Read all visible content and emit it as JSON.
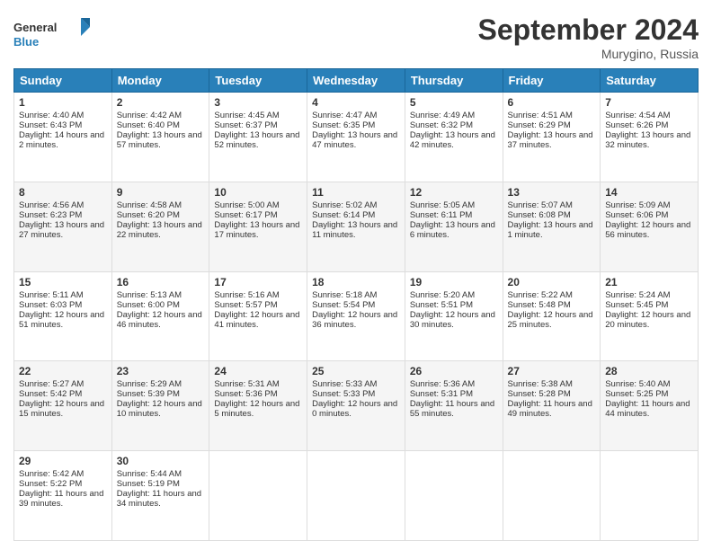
{
  "header": {
    "logo_general": "General",
    "logo_blue": "Blue",
    "month_title": "September 2024",
    "location": "Murygino, Russia"
  },
  "days_of_week": [
    "Sunday",
    "Monday",
    "Tuesday",
    "Wednesday",
    "Thursday",
    "Friday",
    "Saturday"
  ],
  "weeks": [
    [
      {
        "day": "1",
        "sunrise": "Sunrise: 4:40 AM",
        "sunset": "Sunset: 6:43 PM",
        "daylight": "Daylight: 14 hours and 2 minutes."
      },
      {
        "day": "2",
        "sunrise": "Sunrise: 4:42 AM",
        "sunset": "Sunset: 6:40 PM",
        "daylight": "Daylight: 13 hours and 57 minutes."
      },
      {
        "day": "3",
        "sunrise": "Sunrise: 4:45 AM",
        "sunset": "Sunset: 6:37 PM",
        "daylight": "Daylight: 13 hours and 52 minutes."
      },
      {
        "day": "4",
        "sunrise": "Sunrise: 4:47 AM",
        "sunset": "Sunset: 6:35 PM",
        "daylight": "Daylight: 13 hours and 47 minutes."
      },
      {
        "day": "5",
        "sunrise": "Sunrise: 4:49 AM",
        "sunset": "Sunset: 6:32 PM",
        "daylight": "Daylight: 13 hours and 42 minutes."
      },
      {
        "day": "6",
        "sunrise": "Sunrise: 4:51 AM",
        "sunset": "Sunset: 6:29 PM",
        "daylight": "Daylight: 13 hours and 37 minutes."
      },
      {
        "day": "7",
        "sunrise": "Sunrise: 4:54 AM",
        "sunset": "Sunset: 6:26 PM",
        "daylight": "Daylight: 13 hours and 32 minutes."
      }
    ],
    [
      {
        "day": "8",
        "sunrise": "Sunrise: 4:56 AM",
        "sunset": "Sunset: 6:23 PM",
        "daylight": "Daylight: 13 hours and 27 minutes."
      },
      {
        "day": "9",
        "sunrise": "Sunrise: 4:58 AM",
        "sunset": "Sunset: 6:20 PM",
        "daylight": "Daylight: 13 hours and 22 minutes."
      },
      {
        "day": "10",
        "sunrise": "Sunrise: 5:00 AM",
        "sunset": "Sunset: 6:17 PM",
        "daylight": "Daylight: 13 hours and 17 minutes."
      },
      {
        "day": "11",
        "sunrise": "Sunrise: 5:02 AM",
        "sunset": "Sunset: 6:14 PM",
        "daylight": "Daylight: 13 hours and 11 minutes."
      },
      {
        "day": "12",
        "sunrise": "Sunrise: 5:05 AM",
        "sunset": "Sunset: 6:11 PM",
        "daylight": "Daylight: 13 hours and 6 minutes."
      },
      {
        "day": "13",
        "sunrise": "Sunrise: 5:07 AM",
        "sunset": "Sunset: 6:08 PM",
        "daylight": "Daylight: 13 hours and 1 minute."
      },
      {
        "day": "14",
        "sunrise": "Sunrise: 5:09 AM",
        "sunset": "Sunset: 6:06 PM",
        "daylight": "Daylight: 12 hours and 56 minutes."
      }
    ],
    [
      {
        "day": "15",
        "sunrise": "Sunrise: 5:11 AM",
        "sunset": "Sunset: 6:03 PM",
        "daylight": "Daylight: 12 hours and 51 minutes."
      },
      {
        "day": "16",
        "sunrise": "Sunrise: 5:13 AM",
        "sunset": "Sunset: 6:00 PM",
        "daylight": "Daylight: 12 hours and 46 minutes."
      },
      {
        "day": "17",
        "sunrise": "Sunrise: 5:16 AM",
        "sunset": "Sunset: 5:57 PM",
        "daylight": "Daylight: 12 hours and 41 minutes."
      },
      {
        "day": "18",
        "sunrise": "Sunrise: 5:18 AM",
        "sunset": "Sunset: 5:54 PM",
        "daylight": "Daylight: 12 hours and 36 minutes."
      },
      {
        "day": "19",
        "sunrise": "Sunrise: 5:20 AM",
        "sunset": "Sunset: 5:51 PM",
        "daylight": "Daylight: 12 hours and 30 minutes."
      },
      {
        "day": "20",
        "sunrise": "Sunrise: 5:22 AM",
        "sunset": "Sunset: 5:48 PM",
        "daylight": "Daylight: 12 hours and 25 minutes."
      },
      {
        "day": "21",
        "sunrise": "Sunrise: 5:24 AM",
        "sunset": "Sunset: 5:45 PM",
        "daylight": "Daylight: 12 hours and 20 minutes."
      }
    ],
    [
      {
        "day": "22",
        "sunrise": "Sunrise: 5:27 AM",
        "sunset": "Sunset: 5:42 PM",
        "daylight": "Daylight: 12 hours and 15 minutes."
      },
      {
        "day": "23",
        "sunrise": "Sunrise: 5:29 AM",
        "sunset": "Sunset: 5:39 PM",
        "daylight": "Daylight: 12 hours and 10 minutes."
      },
      {
        "day": "24",
        "sunrise": "Sunrise: 5:31 AM",
        "sunset": "Sunset: 5:36 PM",
        "daylight": "Daylight: 12 hours and 5 minutes."
      },
      {
        "day": "25",
        "sunrise": "Sunrise: 5:33 AM",
        "sunset": "Sunset: 5:33 PM",
        "daylight": "Daylight: 12 hours and 0 minutes."
      },
      {
        "day": "26",
        "sunrise": "Sunrise: 5:36 AM",
        "sunset": "Sunset: 5:31 PM",
        "daylight": "Daylight: 11 hours and 55 minutes."
      },
      {
        "day": "27",
        "sunrise": "Sunrise: 5:38 AM",
        "sunset": "Sunset: 5:28 PM",
        "daylight": "Daylight: 11 hours and 49 minutes."
      },
      {
        "day": "28",
        "sunrise": "Sunrise: 5:40 AM",
        "sunset": "Sunset: 5:25 PM",
        "daylight": "Daylight: 11 hours and 44 minutes."
      }
    ],
    [
      {
        "day": "29",
        "sunrise": "Sunrise: 5:42 AM",
        "sunset": "Sunset: 5:22 PM",
        "daylight": "Daylight: 11 hours and 39 minutes."
      },
      {
        "day": "30",
        "sunrise": "Sunrise: 5:44 AM",
        "sunset": "Sunset: 5:19 PM",
        "daylight": "Daylight: 11 hours and 34 minutes."
      },
      null,
      null,
      null,
      null,
      null
    ]
  ]
}
